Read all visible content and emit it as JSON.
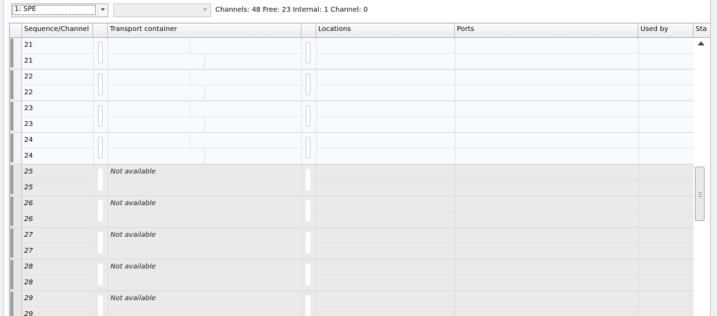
{
  "toolbar": {
    "layer_select": {
      "value": "1: SPE"
    },
    "second_select": {
      "value": ""
    },
    "info": "Channels: 48  Free: 23 Internal: 1 Channel: 0"
  },
  "grid": {
    "columns": [
      "Sequence/Channel",
      "",
      "Transport container",
      "",
      "Locations",
      "Ports",
      "Used by",
      "Sta"
    ],
    "rows": [
      {
        "sequence": "21",
        "channel": "21",
        "status_text": ""
      },
      {
        "sequence": "22",
        "channel": "22",
        "status_text": ""
      },
      {
        "sequence": "23",
        "channel": "23",
        "status_text": ""
      },
      {
        "sequence": "24",
        "channel": "24",
        "status_text": ""
      },
      {
        "sequence": "25",
        "channel": "25",
        "status_text": "Not available"
      },
      {
        "sequence": "26",
        "channel": "26",
        "status_text": "Not available"
      },
      {
        "sequence": "27",
        "channel": "27",
        "status_text": "Not available"
      },
      {
        "sequence": "28",
        "channel": "28",
        "status_text": "Not available"
      },
      {
        "sequence": "29",
        "channel": "29",
        "status_text": "Not available"
      }
    ]
  },
  "colors": {
    "available_row": "#f7fbff",
    "unavailable_row": "#eaeaea",
    "grid_border": "#a0a6ad"
  },
  "icons": {
    "dropdown": "chevron-down-icon",
    "scroll_up": "scroll-up-arrow-icon",
    "scroll_grip": "grip-icon"
  }
}
